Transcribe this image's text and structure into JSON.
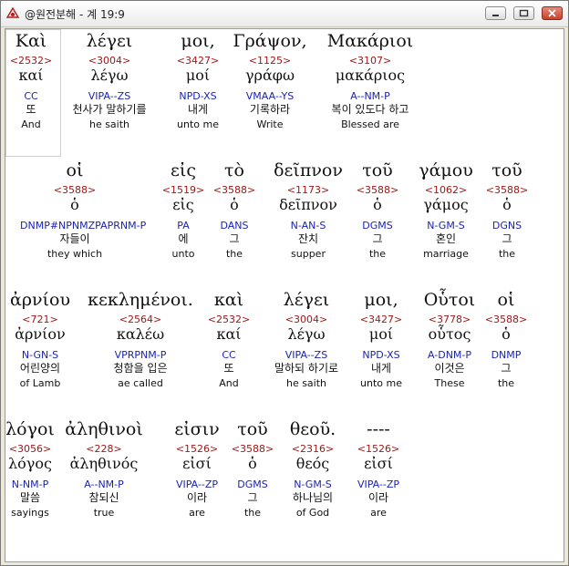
{
  "window": {
    "title": "@원전분해 - 계 19:9"
  },
  "words": [
    {
      "greek": "Καὶ",
      "strong": "<2532>",
      "lemma": "καί",
      "parse": "CC",
      "korean": "또",
      "english": "And"
    },
    {
      "greek": "λέγει",
      "strong": "<3004>",
      "lemma": "λέγω",
      "parse": "VIPA--ZS",
      "korean": "천사가 말하기를",
      "english": "he saith"
    },
    {
      "greek": "μοι,",
      "strong": "<3427>",
      "lemma": "μοί",
      "parse": "NPD-XS",
      "korean": "내게",
      "english": "unto me"
    },
    {
      "greek": "Γράψον,",
      "strong": "<1125>",
      "lemma": "γράφω",
      "parse": "VMAA--YS",
      "korean": "기록하라",
      "english": "Write"
    },
    {
      "greek": "Μακάριοι",
      "strong": "<3107>",
      "lemma": "μακάριος",
      "parse": "A--NM-P",
      "korean": "복이 있도다 하고",
      "english": "Blessed are"
    },
    {
      "greek": "οἱ",
      "strong": "<3588>",
      "lemma": "ὁ",
      "parse": "DNMP#NPNMZPAPRNM-P",
      "korean": "자들이",
      "english": "they which"
    },
    {
      "greek": "εἰς",
      "strong": "<1519>",
      "lemma": "εἰς",
      "parse": "PA",
      "korean": "에",
      "english": "unto"
    },
    {
      "greek": "τὸ",
      "strong": "<3588>",
      "lemma": "ὁ",
      "parse": "DANS",
      "korean": "그",
      "english": "the"
    },
    {
      "greek": "δεῖπνον",
      "strong": "<1173>",
      "lemma": "δεῖπνον",
      "parse": "N-AN-S",
      "korean": "잔치",
      "english": "supper"
    },
    {
      "greek": "τοῦ",
      "strong": "<3588>",
      "lemma": "ὁ",
      "parse": "DGMS",
      "korean": "그",
      "english": "the"
    },
    {
      "greek": "γάμου",
      "strong": "<1062>",
      "lemma": "γάμος",
      "parse": "N-GM-S",
      "korean": "혼인",
      "english": "marriage"
    },
    {
      "greek": "τοῦ",
      "strong": "<3588>",
      "lemma": "ὁ",
      "parse": "DGNS",
      "korean": "그",
      "english": "the"
    },
    {
      "greek": "ἀρνίου",
      "strong": "<721>",
      "lemma": "ἀρνίον",
      "parse": "N-GN-S",
      "korean": "어린양의",
      "english": "of Lamb"
    },
    {
      "greek": "κεκλημένοι.",
      "strong": "<2564>",
      "lemma": "καλέω",
      "parse": "VPRPNM-P",
      "korean": "청함을 입은",
      "english": "ae called"
    },
    {
      "greek": "καὶ",
      "strong": "<2532>",
      "lemma": "καί",
      "parse": "CC",
      "korean": "또",
      "english": "And"
    },
    {
      "greek": "λέγει",
      "strong": "<3004>",
      "lemma": "λέγω",
      "parse": "VIPA--ZS",
      "korean": "말하되 하기로",
      "english": "he saith"
    },
    {
      "greek": "μοι,",
      "strong": "<3427>",
      "lemma": "μοί",
      "parse": "NPD-XS",
      "korean": "내게",
      "english": "unto me"
    },
    {
      "greek": "Οὗτοι",
      "strong": "<3778>",
      "lemma": "οὗτος",
      "parse": "A-DNM-P",
      "korean": "이것은",
      "english": "These"
    },
    {
      "greek": "οἱ",
      "strong": "<3588>",
      "lemma": "ὁ",
      "parse": "DNMP",
      "korean": "그",
      "english": "the"
    },
    {
      "greek": "λόγοι",
      "strong": "<3056>",
      "lemma": "λόγος",
      "parse": "N-NM-P",
      "korean": "말씀",
      "english": "sayings"
    },
    {
      "greek": "ἀληθινοὶ",
      "strong": "<228>",
      "lemma": "ἀληθινός",
      "parse": "A--NM-P",
      "korean": "참되신",
      "english": "true"
    },
    {
      "greek": "εἰσιν",
      "strong": "<1526>",
      "lemma": "εἰσί",
      "parse": "VIPA--ZP",
      "korean": "이라",
      "english": "are"
    },
    {
      "greek": "τοῦ",
      "strong": "<3588>",
      "lemma": "ὁ",
      "parse": "DGMS",
      "korean": "그",
      "english": "the"
    },
    {
      "greek": "θεοῦ.",
      "strong": "<2316>",
      "lemma": "θεός",
      "parse": "N-GM-S",
      "korean": "하나님의",
      "english": "of God"
    },
    {
      "greek": "----",
      "strong": "<1526>",
      "lemma": "εἰσί",
      "parse": "VIPA--ZP",
      "korean": "이라",
      "english": "are"
    }
  ]
}
